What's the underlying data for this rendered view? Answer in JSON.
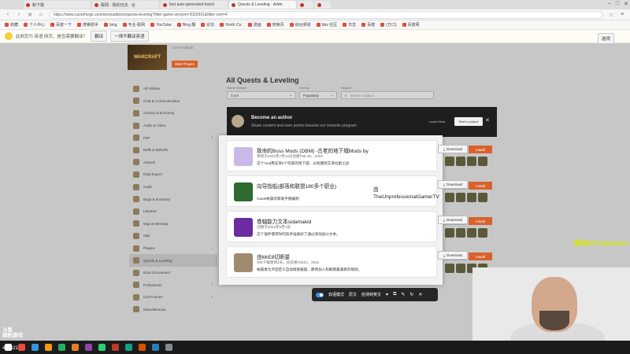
{
  "browser": {
    "tabs": [
      {
        "label": "和下载",
        "active": false
      },
      {
        "label": "联网 · 我的玩法 · 合",
        "active": false
      },
      {
        "label": "fast auto-generated transl",
        "active": false
      },
      {
        "label": "Quests & Leveling · Addo",
        "active": true
      },
      {
        "label": "",
        "active": false
      },
      {
        "label": "",
        "active": false
      }
    ],
    "url": "https://www.curseforge.com/wow/addons/quests-leveling?filter-game-version=2020301&filter-sort=4",
    "bookmarks": [
      "收藏",
      "个人中心",
      "百度一下",
      "搜索助手",
      "bing",
      "专业·联网",
      "YouTube",
      "Bing 翻",
      "论坛",
      "North Co.",
      "漫画",
      "搜索页",
      "综合频道",
      "bbs 社区",
      "日志",
      "百度",
      "(万口)",
      "百度网"
    ],
    "translate": {
      "prompt": "此网页为 英语 网页，是否需要翻译？",
      "translate_btn": "翻译",
      "never_btn": "一律不翻译英语",
      "options_btn": "选项"
    }
  },
  "page": {
    "game_title": "WARCRAFT",
    "game_text": "1,074 Addons",
    "create_btn": "Start Project",
    "title": "All Quests & Leveling",
    "filters": [
      {
        "label": "Game Version",
        "value": "3.4.0"
      },
      {
        "label": "Sort by",
        "value": "Popularity"
      },
      {
        "label": "Search",
        "value": "Search Addons"
      }
    ],
    "sidebar": [
      {
        "label": "All Addons",
        "active": false,
        "arrow": ""
      },
      {
        "label": "Chat & Communication",
        "active": false,
        "arrow": ""
      },
      {
        "label": "Auction & Economy",
        "active": false,
        "arrow": ""
      },
      {
        "label": "Audio & Video",
        "active": false,
        "arrow": ""
      },
      {
        "label": "PvP",
        "active": false,
        "arrow": "›"
      },
      {
        "label": "Buffs & Debuffs",
        "active": false,
        "arrow": ""
      },
      {
        "label": "Artwork",
        "active": false,
        "arrow": ""
      },
      {
        "label": "Data Export",
        "active": false,
        "arrow": ""
      },
      {
        "label": "Guild",
        "active": false,
        "arrow": ""
      },
      {
        "label": "Bags & Inventory",
        "active": false,
        "arrow": ""
      },
      {
        "label": "Libraries",
        "active": false,
        "arrow": ""
      },
      {
        "label": "Map & Minimap",
        "active": false,
        "arrow": ""
      },
      {
        "label": "Mail",
        "active": false,
        "arrow": ""
      },
      {
        "label": "Plugins",
        "active": false,
        "arrow": "›"
      },
      {
        "label": "Quests & Leveling",
        "active": true,
        "arrow": ""
      },
      {
        "label": "Boss Encounters",
        "active": false,
        "arrow": ""
      },
      {
        "label": "Professions",
        "active": false,
        "arrow": "›"
      },
      {
        "label": "Unit Frames",
        "active": false,
        "arrow": "›"
      },
      {
        "label": "Miscellaneous",
        "active": false,
        "arrow": ""
      }
    ],
    "banner": {
      "title": "Become an author",
      "subtitle": "Share content and earn points towards our rewards program",
      "learn": "Learn More",
      "start": "Start a project",
      "close": "✕"
    },
    "list_download": "Download",
    "list_install": "Install"
  },
  "popup": {
    "cards": [
      {
        "title": "致命的Boss Mods (DBM) -古老的地下城Mods by",
        "sub": "更新于2022年7月14日创建Feb 20，2019",
        "desc": "这个mod用支持5个玩家的地下城、从经典到艾泽拉斯之战",
        "author": "",
        "download": "Download",
        "icon_color": "#c9b8e8"
      },
      {
        "title": "向导指船(部落和联盟180多个职业)",
        "sub": "",
        "desc": "Guide帐篇的帮助手册编制",
        "author": "由 TheUnprofessionalGamerTV",
        "download": "Download",
        "icon_color": "#2e6b2e"
      },
      {
        "title": "卷轴能力文本sidamakid",
        "sub": "创建于2022年6月1日",
        "desc": "这个插件使得你的技术准备好了通过滚动战斗文本。",
        "author": "",
        "download": "Download",
        "icon_color": "#6a2ca0"
      },
      {
        "title": "由MrE8切断量",
        "sub": "305下载更新4天，创造者Feb22，2022",
        "desc": "帐篇者允许团定义自动接受援艇、那场加入和解锁最满意的规则。",
        "author": "",
        "download": "Download",
        "icon_color": "#a08a70"
      }
    ]
  },
  "translate_toolbar": {
    "mode": "双语模式",
    "original": "原文",
    "target": "检测到英文"
  },
  "overlay": {
    "watermark": "黑袍WX:likeisthis",
    "stream_logo": "斗鱼\n猎豹游戏",
    "stream_id": "456621"
  }
}
